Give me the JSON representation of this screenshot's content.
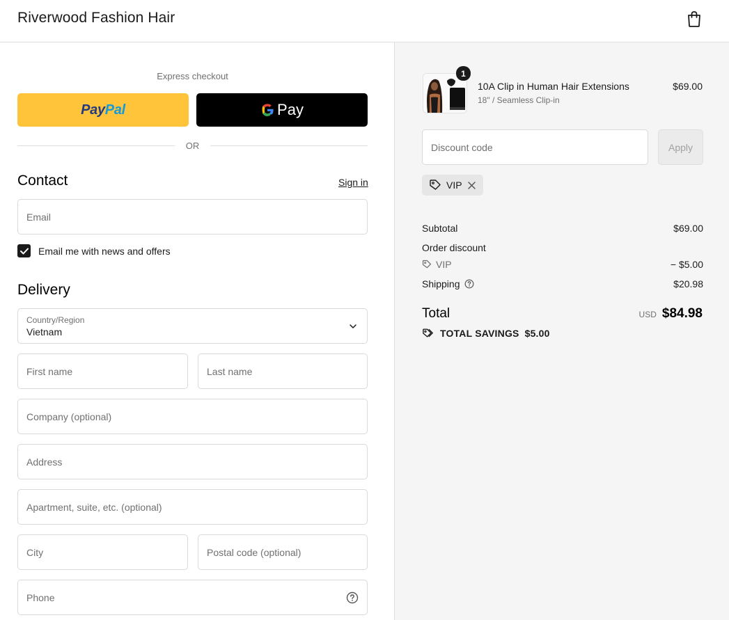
{
  "header": {
    "store_name": "Riverwood Fashion Hair",
    "cart_icon": "shopping-bag-icon"
  },
  "express": {
    "label": "Express checkout",
    "paypal_label_a": "Pay",
    "paypal_label_b": "Pal",
    "gpay_label": "Pay",
    "or_text": "OR"
  },
  "contact": {
    "title": "Contact",
    "sign_in": "Sign in",
    "email_placeholder": "Email",
    "newsletter_label": "Email me with news and offers",
    "newsletter_checked": true
  },
  "delivery": {
    "title": "Delivery",
    "country_label": "Country/Region",
    "country_value": "Vietnam",
    "first_name": "First name",
    "last_name": "Last name",
    "company": "Company (optional)",
    "address": "Address",
    "apartment": "Apartment, suite, etc. (optional)",
    "city": "City",
    "postal": "Postal code (optional)",
    "phone": "Phone"
  },
  "order": {
    "item": {
      "quantity": "1",
      "name": "10A Clip in Human Hair Extensions",
      "variant": "18\" / Seamless Clip-in",
      "price": "$69.00"
    },
    "discount_placeholder": "Discount code",
    "apply_label": "Apply",
    "applied_code": "VIP",
    "subtotal_label": "Subtotal",
    "subtotal_value": "$69.00",
    "order_discount_label": "Order discount",
    "discount_code_label": "VIP",
    "discount_value": "− $5.00",
    "shipping_label": "Shipping",
    "shipping_value": "$20.98",
    "total_label": "Total",
    "total_currency": "USD",
    "total_value": "$84.98",
    "savings_label": "TOTAL SAVINGS",
    "savings_value": "$5.00"
  },
  "colors": {
    "paypal_yellow": "#ffc439",
    "paypal_blue_dark": "#253b80",
    "paypal_blue_light": "#179bd7",
    "right_panel_bg": "#f5f5f5"
  }
}
